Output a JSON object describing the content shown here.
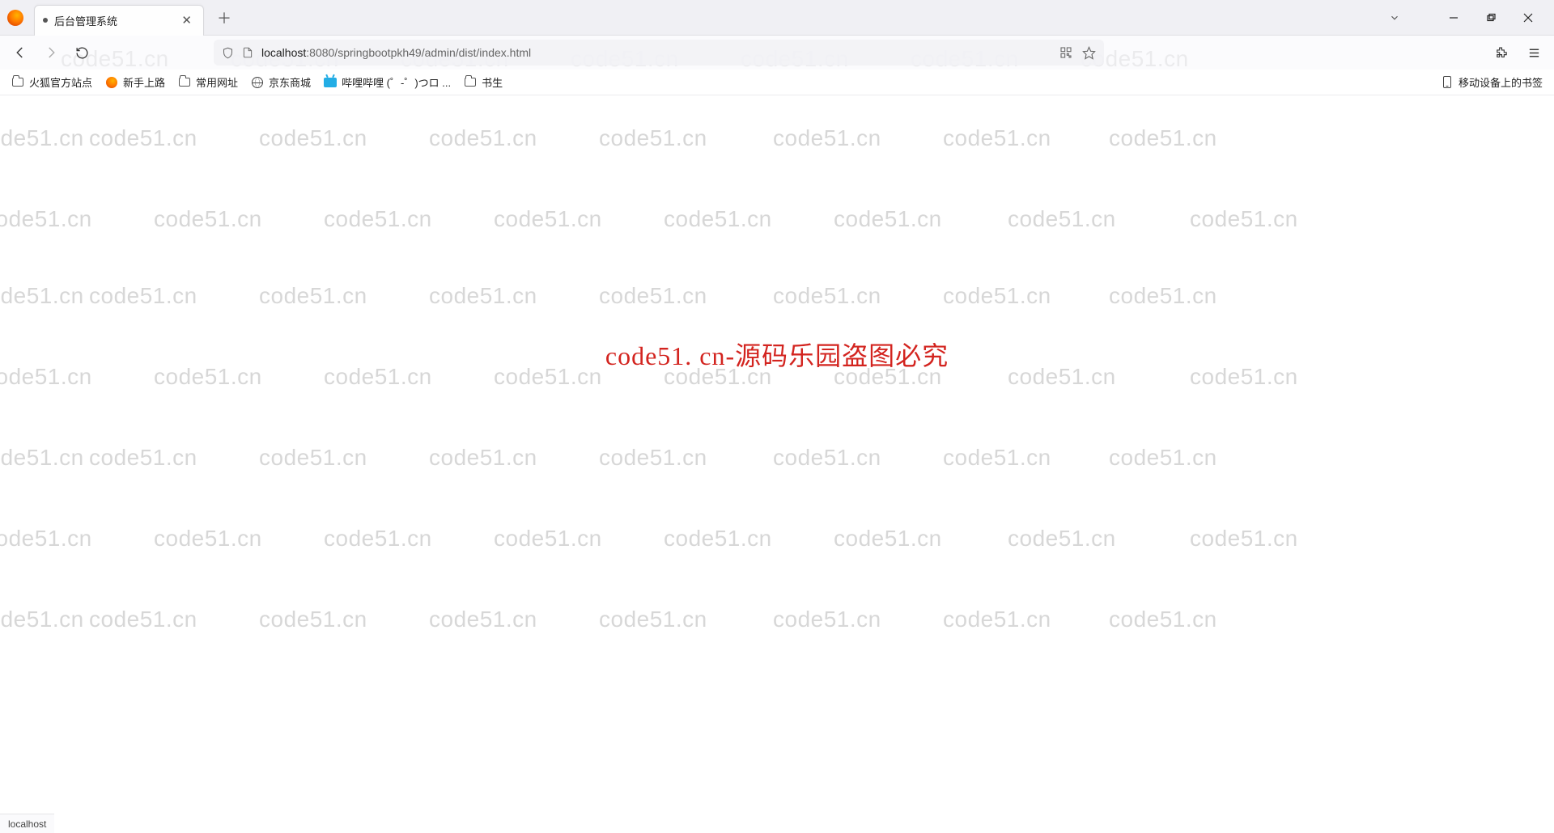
{
  "window": {
    "tab_title": "后台管理系统",
    "url_host": "localhost",
    "url_path": ":8080/springbootpkh49/admin/dist/index.html",
    "status_text": "localhost"
  },
  "bookmarks": {
    "items": [
      {
        "label": "火狐官方站点",
        "icon": "folder"
      },
      {
        "label": "新手上路",
        "icon": "firefox"
      },
      {
        "label": "常用网址",
        "icon": "folder"
      },
      {
        "label": "京东商城",
        "icon": "globe"
      },
      {
        "label": "哔哩哔哩 (゜-゜)つロ ...",
        "icon": "bilibili"
      },
      {
        "label": "书生",
        "icon": "folder"
      }
    ],
    "mobile_label": "移动设备上的书签"
  },
  "page": {
    "center_watermark_text": "code51. cn-源码乐园盗图必究"
  },
  "watermark": {
    "text": "code51.cn"
  }
}
